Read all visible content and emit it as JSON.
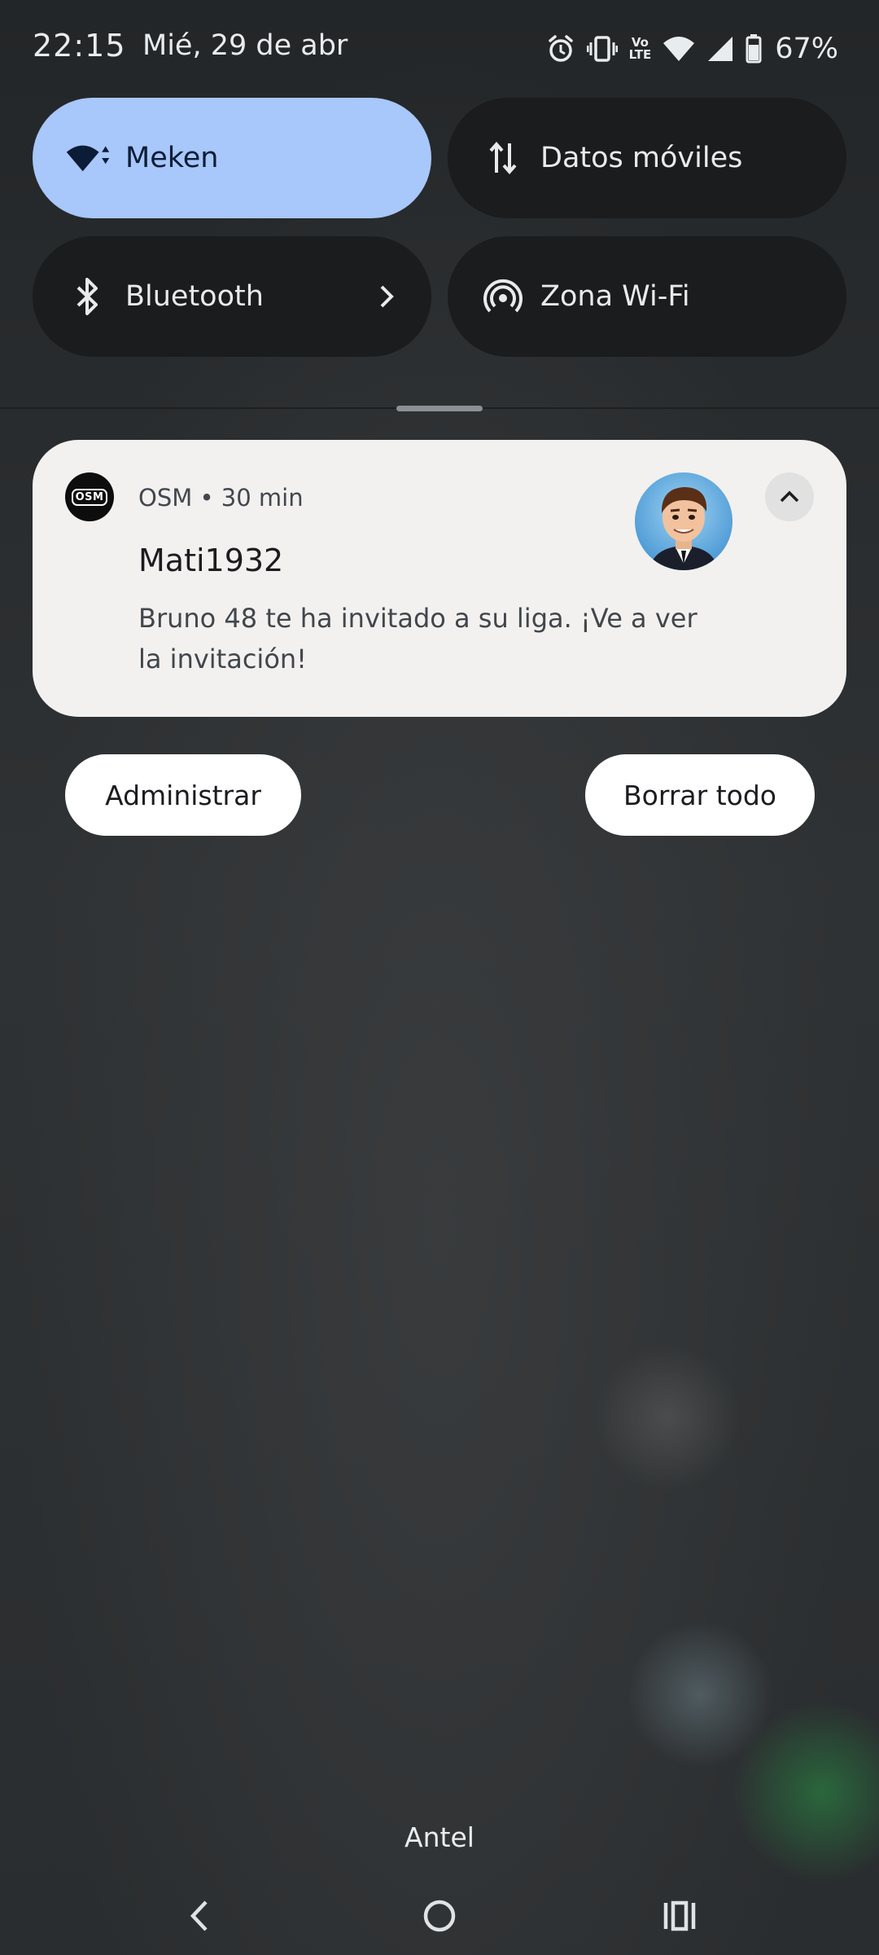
{
  "status_bar": {
    "time": "22:15",
    "date": "Mié, 29 de abr",
    "battery_percent": "67%",
    "volte_label_top": "Vo",
    "volte_label_bottom": "LTE",
    "icons": [
      "alarm-icon",
      "vibrate-icon",
      "volte-icon",
      "wifi-icon",
      "cell-signal-icon",
      "battery-icon"
    ]
  },
  "quick_settings": {
    "wifi": {
      "label": "Meken",
      "icon": "wifi-icon",
      "active": true
    },
    "mobile_data": {
      "label": "Datos móviles",
      "icon": "data-arrows-icon",
      "active": false
    },
    "bluetooth": {
      "label": "Bluetooth",
      "icon": "bluetooth-icon",
      "active": false,
      "chevron": "chevron-right-icon"
    },
    "hotspot": {
      "label": "Zona Wi-Fi",
      "icon": "hotspot-icon",
      "active": false
    }
  },
  "notification": {
    "app_icon_text": "OSM",
    "meta": "OSM • 30 min",
    "title": "Mati1932",
    "body": "Bruno 48 te ha invitado a su liga. ¡Ve a ver la invitación!",
    "avatar": "avatar-cartoon-man",
    "expand_icon": "chevron-up-icon"
  },
  "actions": {
    "manage_label": "Administrar",
    "clear_all_label": "Borrar todo"
  },
  "carrier": "Antel",
  "navigation": {
    "back": "back-icon",
    "home": "home-icon",
    "recents": "recents-icon"
  },
  "colors": {
    "tile_active": "#a8c7fa",
    "tile_inactive": "#1a1c1d",
    "notification_bg": "#f2f1ef",
    "scrim": "#2b2e30"
  }
}
